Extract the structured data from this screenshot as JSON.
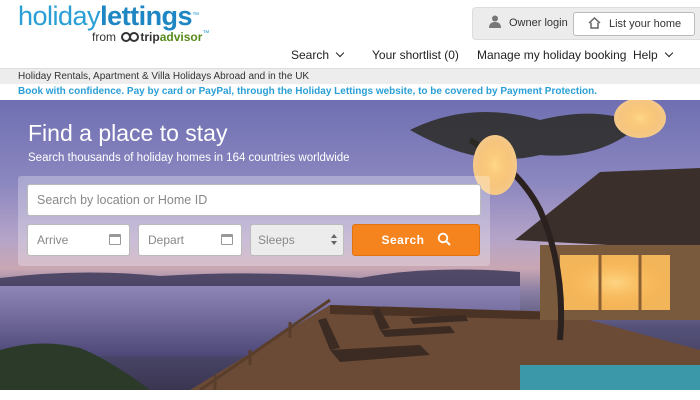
{
  "logo": {
    "word1": "holiday",
    "word2": "lettings",
    "trademark": "™",
    "from": "from",
    "brand_trip": "trip",
    "brand_advisor": "advisor",
    "brand_tm": "™"
  },
  "account": {
    "owner_login": "Owner login",
    "list_home": "List your home"
  },
  "nav": {
    "search": "Search",
    "shortlist": "Your shortlist (0)",
    "manage": "Manage my holiday booking",
    "help": "Help"
  },
  "tagline": "Holiday Rentals, Apartment & Villa Holidays Abroad and in the UK",
  "info": "Book with confidence. Pay by card or PayPal, through the Holiday Lettings website, to be covered by Payment Protection.",
  "hero": {
    "title": "Find a place to stay",
    "subtitle": "Search thousands of holiday homes in 164 countries worldwide"
  },
  "search": {
    "placeholder": "Search by location or Home ID",
    "arrive": "Arrive",
    "depart": "Depart",
    "sleeps": "Sleeps",
    "button": "Search"
  },
  "icons": {
    "owner": "user-icon",
    "list": "house-icon",
    "calendar": "calendar-icon",
    "search": "magnifier-icon"
  },
  "colors": {
    "brand_blue": "#2a9fd6",
    "search_orange": "#f5841f",
    "tripadvisor_green": "#588a1b"
  }
}
